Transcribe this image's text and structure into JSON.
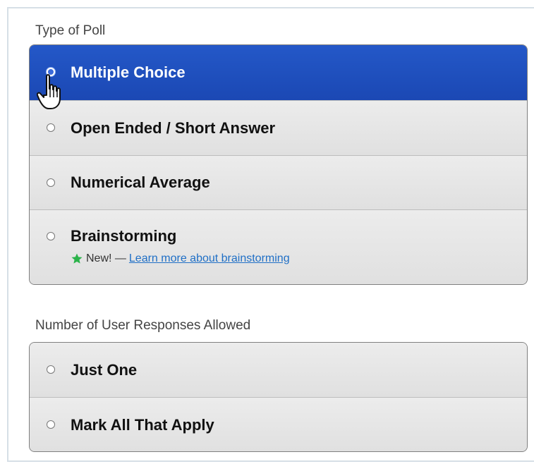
{
  "poll_type": {
    "label": "Type of Poll",
    "options": [
      {
        "label": "Multiple Choice",
        "selected": true
      },
      {
        "label": "Open Ended / Short Answer",
        "selected": false
      },
      {
        "label": "Numerical Average",
        "selected": false
      },
      {
        "label": "Brainstorming",
        "selected": false
      }
    ],
    "brainstorming_note": {
      "badge": "New! —",
      "link": "Learn more about brainstorming",
      "icon": "star-icon",
      "icon_color": "#2bb34a"
    }
  },
  "responses": {
    "label": "Number of User Responses Allowed",
    "options": [
      {
        "label": "Just One",
        "selected": false
      },
      {
        "label": "Mark All That Apply",
        "selected": false
      }
    ]
  },
  "colors": {
    "selected_bg": "#2458c8",
    "option_bg": "#e4e4e4",
    "link": "#1f6fc6"
  }
}
